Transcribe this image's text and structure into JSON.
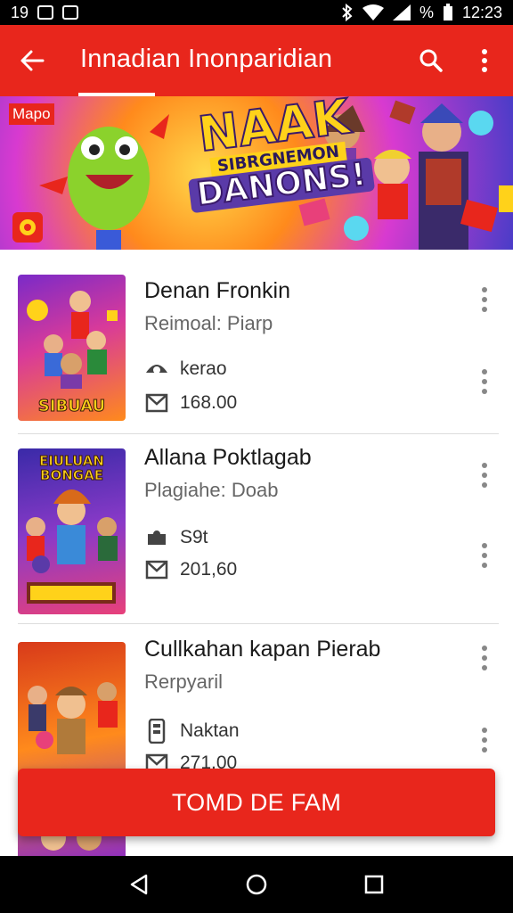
{
  "status_bar": {
    "time": "12:23",
    "left_text": "19",
    "battery": "%"
  },
  "app_bar": {
    "title": "Innadian Inonparidian",
    "back_icon": "arrow-back-icon",
    "search_icon": "search-icon",
    "menu_icon": "more-vert-icon"
  },
  "banner": {
    "badge": "Mapo",
    "title_line1": "NAAK",
    "title_line2": "SIBRGNEMON",
    "title_line3": "DANONS!"
  },
  "items": [
    {
      "title": "Denan Fronkin",
      "subtitle": "Reimoal: Piarp",
      "meta1_icon": "eye-icon",
      "meta1_text": "kerao",
      "meta2_icon": "mail-icon",
      "meta2_text": "168.00",
      "thumb_caption": "SIBUAU"
    },
    {
      "title": "Allana Poktlagab",
      "subtitle": "Plagiahe: Doab",
      "meta1_icon": "puzzle-icon",
      "meta1_text": "S9t",
      "meta2_icon": "mail-icon",
      "meta2_text": "201,60",
      "thumb_top": "EIULUAN BONGAE"
    },
    {
      "title": "Cullkahan kapan Pierab",
      "subtitle": "Rerpyaril",
      "meta1_icon": "phone-icon",
      "meta1_text": "Naktan",
      "meta2_icon": "mail-icon",
      "meta2_text": "271.00"
    }
  ],
  "cta": {
    "label": "TOMD DE FAM"
  },
  "colors": {
    "primary": "#e8261c",
    "status_bar": "#000000"
  }
}
